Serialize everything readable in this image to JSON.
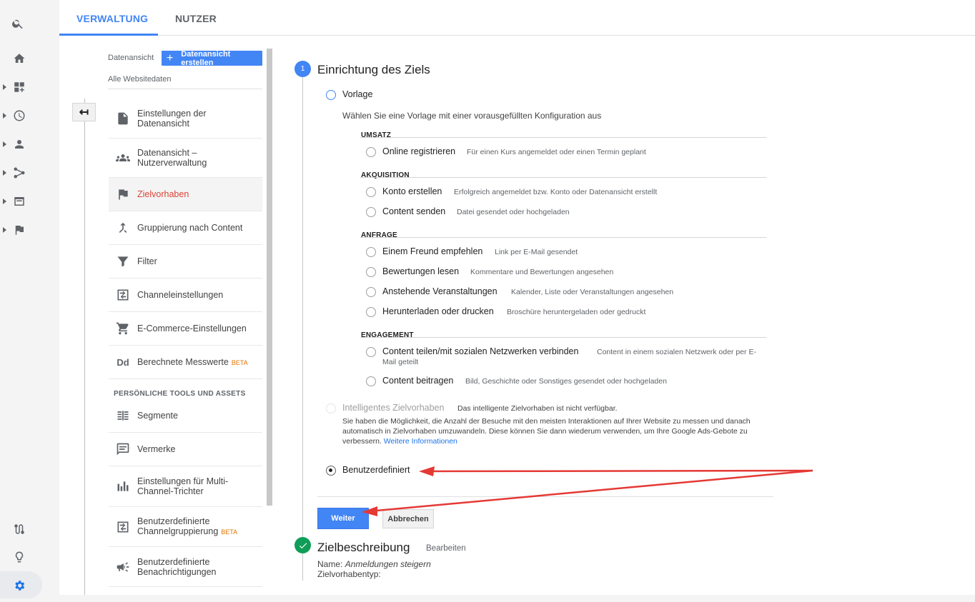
{
  "tabs": [
    {
      "label": "VERWALTUNG",
      "active": true
    },
    {
      "label": "NUTZER",
      "active": false
    }
  ],
  "leftbar_icons": [
    "search-icon",
    "home-icon",
    "dashboard-icon",
    "clock-icon",
    "person-icon",
    "acquisition-icon",
    "behavior-icon",
    "flag-icon",
    "route-icon",
    "lightbulb-icon",
    "gear-icon"
  ],
  "sidebar": {
    "view_label": "Datenansicht",
    "create_view_label": "Datenansicht erstellen",
    "view_name": "Alle Websitedaten",
    "items": [
      {
        "label": "Einstellungen der Datenansicht",
        "icon": "document-icon"
      },
      {
        "label": "Datenansicht – Nutzerverwaltung",
        "icon": "people-icon"
      },
      {
        "label": "Zielvorhaben",
        "icon": "flag-icon",
        "active": true
      },
      {
        "label": "Gruppierung nach Content",
        "icon": "merge-icon"
      },
      {
        "label": "Filter",
        "icon": "funnel-icon"
      },
      {
        "label": "Channeleinstellungen",
        "icon": "channel-icon"
      },
      {
        "label": "E-Commerce-Einstellungen",
        "icon": "cart-icon"
      },
      {
        "label": "Berechnete Messwerte",
        "icon": "dd-icon",
        "badge": "BETA",
        "icon_text": "Dd"
      }
    ],
    "section_title": "PERSÖNLICHE TOOLS UND ASSETS",
    "tools": [
      {
        "label": "Segmente",
        "icon": "segments-icon"
      },
      {
        "label": "Vermerke",
        "icon": "comment-icon"
      },
      {
        "label": "Einstellungen für Multi-Channel-Trichter",
        "icon": "bar-chart-icon"
      },
      {
        "label": "Benutzerdefinierte Channelgruppierung",
        "icon": "channel-icon",
        "badge": "BETA"
      },
      {
        "label": "Benutzerdefinierte Benachrichtigungen",
        "icon": "megaphone-icon"
      }
    ]
  },
  "goal_setup": {
    "step_number": "1",
    "title": "Einrichtung des Ziels",
    "template_label": "Vorlage",
    "template_desc": "Wählen Sie eine Vorlage mit einer vorausgefüllten Konfiguration aus",
    "categories": [
      {
        "name": "UMSATZ",
        "options": [
          {
            "label": "Online registrieren",
            "desc": "Für einen Kurs angemeldet oder einen Termin geplant"
          }
        ]
      },
      {
        "name": "AKQUISITION",
        "options": [
          {
            "label": "Konto erstellen",
            "desc": "Erfolgreich angemeldet bzw. Konto oder Datenansicht erstellt"
          },
          {
            "label": "Content senden",
            "desc": "Datei gesendet oder hochgeladen"
          }
        ]
      },
      {
        "name": "ANFRAGE",
        "options": [
          {
            "label": "Einem Freund empfehlen",
            "desc": "Link per E-Mail gesendet"
          },
          {
            "label": "Bewertungen lesen",
            "desc": "Kommentare und Bewertungen angesehen"
          },
          {
            "label": "Anstehende Veranstaltungen",
            "desc": "Kalender, Liste oder Veranstaltungen angesehen"
          },
          {
            "label": "Herunterladen oder drucken",
            "desc": "Broschüre heruntergeladen oder gedruckt"
          }
        ]
      },
      {
        "name": "ENGAGEMENT",
        "options": [
          {
            "label": "Content teilen/mit sozialen Netzwerken verbinden",
            "desc": "Content in einem sozialen Netzwerk oder per E-",
            "desc2": "Mail geteilt"
          },
          {
            "label": "Content beitragen",
            "desc": "Bild, Geschichte oder Sonstiges gesendet oder hochgeladen"
          }
        ]
      }
    ],
    "smart_goal_label": "Intelligentes Zielvorhaben",
    "smart_goal_unavailable": "Das intelligente Zielvorhaben ist nicht verfügbar.",
    "smart_goal_text": "Sie haben die Möglichkeit, die Anzahl der Besuche mit den meisten Interaktionen auf Ihrer Website zu messen und danach automatisch in Zielvorhaben umzuwandeln. Diese können Sie dann wiederum verwenden, um Ihre Google Ads-Gebote zu verbessern.",
    "more_info_link": "Weitere Informationen",
    "custom_label": "Benutzerdefiniert",
    "continue_label": "Weiter",
    "cancel_label": "Abbrechen"
  },
  "goal_description": {
    "title": "Zielbeschreibung",
    "edit_label": "Bearbeiten",
    "name_label": "Name:",
    "name_value": "Anmeldungen steigern",
    "type_label": "Zielvorhabentyp:"
  },
  "colors": {
    "accent": "#4285f4",
    "active_item": "#db4437",
    "success": "#0f9d58",
    "annotation_arrow": "#e53935"
  }
}
